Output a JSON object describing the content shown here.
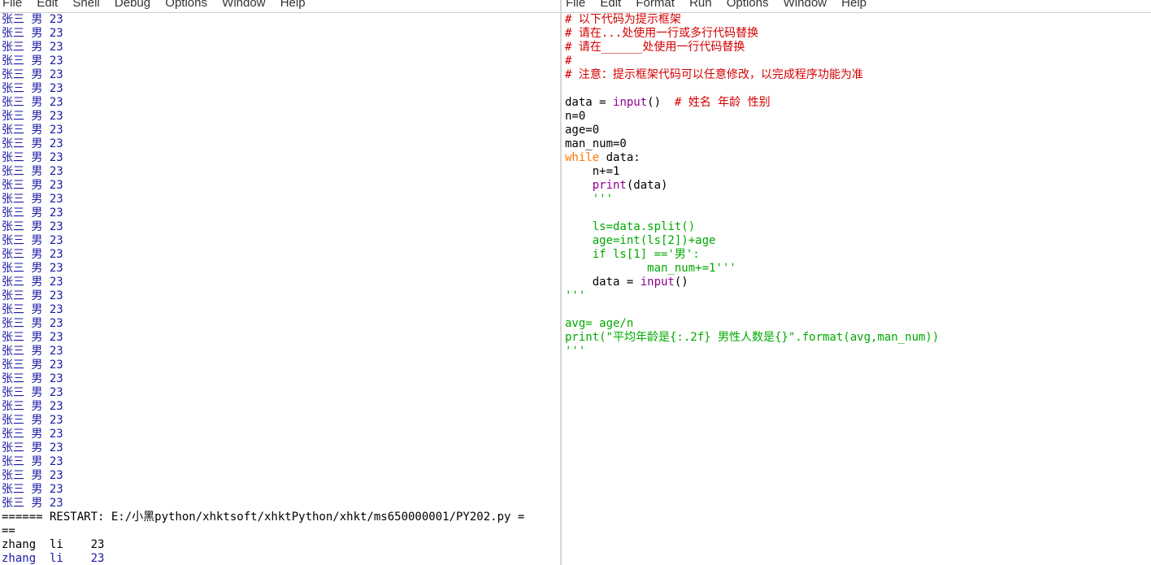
{
  "shell": {
    "menu": [
      "File",
      "Edit",
      "Shell",
      "Debug",
      "Options",
      "Window",
      "Help"
    ],
    "output_lines": [
      "张三 男 23",
      "张三 男 23",
      "张三 男 23",
      "张三 男 23",
      "张三 男 23",
      "张三 男 23",
      "张三 男 23",
      "张三 男 23",
      "张三 男 23",
      "张三 男 23",
      "张三 男 23",
      "张三 男 23",
      "张三 男 23",
      "张三 男 23",
      "张三 男 23",
      "张三 男 23",
      "张三 男 23",
      "张三 男 23",
      "张三 男 23",
      "张三 男 23",
      "张三 男 23",
      "张三 男 23",
      "张三 男 23",
      "张三 男 23",
      "张三 男 23",
      "张三 男 23",
      "张三 男 23",
      "张三 男 23",
      "张三 男 23",
      "张三 男 23",
      "张三 男 23",
      "张三 男 23",
      "张三 男 23",
      "张三 男 23",
      "张三 男 23",
      "张三 男 23"
    ],
    "restart_line": "====== RESTART: E:/小黑python/xhktsoft/xhktPython/xhkt/ms650000001/PY202.py =",
    "restart_cont": "==",
    "input_line": "zhang  li    23",
    "echo_line": "zhang  li    23"
  },
  "editor": {
    "menu": [
      "File",
      "Edit",
      "Format",
      "Run",
      "Options",
      "Window",
      "Help"
    ],
    "code": {
      "c1": "# 以下代码为提示框架",
      "c2": "# 请在...处使用一行或多行代码替换",
      "c3": "# 请在______处使用一行代码替换",
      "c4": "#",
      "c5": "# 注意：提示框架代码可以任意修改，以完成程序功能为准",
      "blank": "",
      "l7a": "data = ",
      "l7b": "input",
      "l7c": "()  ",
      "l7d": "# 姓名 年龄 性别",
      "l8": "n=0",
      "l9": "age=0",
      "l10": "man_num=0",
      "l11a": "while",
      "l11b": " data:",
      "l12": "    n+=1",
      "l13a": "    ",
      "l13b": "print",
      "l13c": "(data)",
      "l14": "    '''",
      "l16": "    ls=data.split()",
      "l17": "    age=int(ls[2])+age",
      "l18": "    if ls[1] =='男':",
      "l19": "            man_num+=1'''",
      "l20a": "    data = ",
      "l20b": "input",
      "l20c": "()",
      "l21": "'''",
      "l23": "avg= age/n",
      "l24": "print(\"平均年龄是{:.2f} 男性人数是{}\".format(avg,man_num))",
      "l25": "'''"
    }
  }
}
